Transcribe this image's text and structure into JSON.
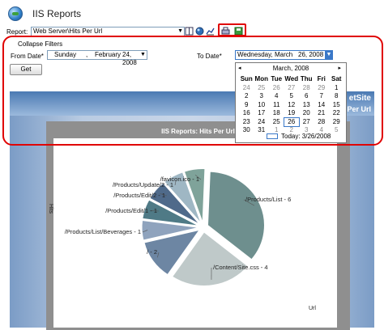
{
  "app": {
    "title": "IIS Reports"
  },
  "report": {
    "label": "Report:",
    "selected": "Web Server\\Hits Per Url"
  },
  "toolbar": {
    "icons": [
      "book-icon",
      "globe-report-icon",
      "chart-icon",
      "print-icon",
      "save-icon"
    ]
  },
  "filters": {
    "collapse_label": "Collapse Filters",
    "from_label": "From Date*",
    "from": {
      "weekday": "Sunday",
      "sep": ",",
      "month": "February",
      "day": "24, 2008"
    },
    "to_label": "To Date*",
    "to": {
      "weekday": "Wednesday,",
      "month": "March",
      "day": "26, 2008"
    },
    "get_label": "Get"
  },
  "calendar": {
    "month": "March, 2008",
    "prev": "◂",
    "next": "▸",
    "days": [
      "Sun",
      "Mon",
      "Tue",
      "Wed",
      "Thu",
      "Fri",
      "Sat"
    ],
    "weeks": [
      [
        "24",
        "25",
        "26",
        "27",
        "28",
        "29",
        "1"
      ],
      [
        "2",
        "3",
        "4",
        "5",
        "6",
        "7",
        "8"
      ],
      [
        "9",
        "10",
        "11",
        "12",
        "13",
        "14",
        "15"
      ],
      [
        "16",
        "17",
        "18",
        "19",
        "20",
        "21",
        "22"
      ],
      [
        "23",
        "24",
        "25",
        "26",
        "27",
        "28",
        "29"
      ],
      [
        "30",
        "31",
        "1",
        "2",
        "3",
        "4",
        "5"
      ]
    ],
    "today_label": "Today: 3/26/2008"
  },
  "banner": {
    "text1": "etSite",
    "text2": "Per Url"
  },
  "chart_data": {
    "type": "pie",
    "title": "IIS Reports: Hits Per Url",
    "xlabel": "Url",
    "ylabel": "Hits",
    "categories": [
      "/Products/List",
      "/Content/Site.css",
      "/",
      "/Products/List/Beverages",
      "/Products/Edit/1",
      "/Products/Edit/2",
      "/Products/Update/2",
      "/favicon.ico"
    ],
    "values": [
      6,
      4,
      2,
      1,
      1,
      1,
      1,
      1
    ],
    "data_labels": [
      "/Products/List - 6",
      "/Content/Site.css - 4",
      "/ - 2",
      "/Products/List/Beverages - 1",
      "/Products/Edit/1 - 1",
      "/Products/Edit/2 - 1",
      "/Products/Update/2 - 1",
      "/favicon.ico - 1"
    ],
    "colors": [
      "#6e8f8e",
      "#bfc9c9",
      "#6d86a3",
      "#8fa3bd",
      "#4f7a86",
      "#4f6a8a",
      "#9fb7c4",
      "#7fa39a"
    ]
  }
}
